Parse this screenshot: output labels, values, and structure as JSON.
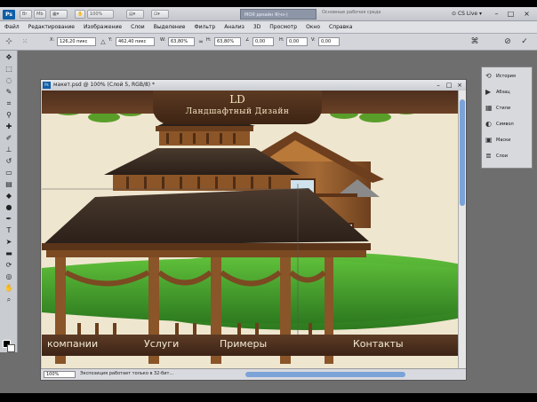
{
  "topbar": {
    "app_logo": "Ps",
    "zoom_chip": "100%",
    "workspace_active": "МОЯ дизайн Я(чз-)",
    "workspace_other": "Основные рабочая среда",
    "cs_live": "CS Live",
    "min": "–",
    "max": "□",
    "close": "×"
  },
  "menu": [
    "Файл",
    "Редактирование",
    "Изображение",
    "Слои",
    "Выделение",
    "Фильтр",
    "Анализ",
    "3D",
    "Просмотр",
    "Окно",
    "Справка"
  ],
  "options": {
    "x_label": "X:",
    "x_value": "126,20 пикс",
    "y_label": "Y:",
    "y_value": "462,40 пикс",
    "w_label": "W:",
    "w_value": "63,80%",
    "h_label": "H:",
    "h_value": "63,80%",
    "angle_label": "∠",
    "angle_value": "0,00",
    "hskew_label": "H:",
    "hskew_value": "0,00",
    "vskew_label": "V:",
    "vskew_value": "0,00",
    "cancel_icon": "⊘",
    "commit_icon": "✓"
  },
  "document": {
    "title": "макет.psd @ 100% (Слой 5, RGB/8) *",
    "zoom": "100%",
    "status": "Экспозиция работает только в 32-бит..."
  },
  "panels": [
    {
      "icon": "history-icon",
      "glyph": "⟲",
      "label": "История"
    },
    {
      "icon": "actions-icon",
      "glyph": "▶",
      "label": "Абзац"
    },
    {
      "icon": "styles-icon",
      "glyph": "▦",
      "label": "Стили"
    },
    {
      "icon": "adjustments-icon",
      "glyph": "◐",
      "label": "Символ"
    },
    {
      "icon": "masks-icon",
      "glyph": "▣",
      "label": "Маски"
    },
    {
      "icon": "layers-icon",
      "glyph": "≣",
      "label": "Слои"
    }
  ],
  "site": {
    "logo_mark": "LD",
    "logo_text": "Ландшафтный Дизайн",
    "nav": [
      "компании",
      "Услуги",
      "Примеры",
      "Контакты"
    ]
  },
  "colors": {
    "accent": "#0f5ea8",
    "wood": "#5c3b25",
    "grass": "#3f9a2b"
  }
}
